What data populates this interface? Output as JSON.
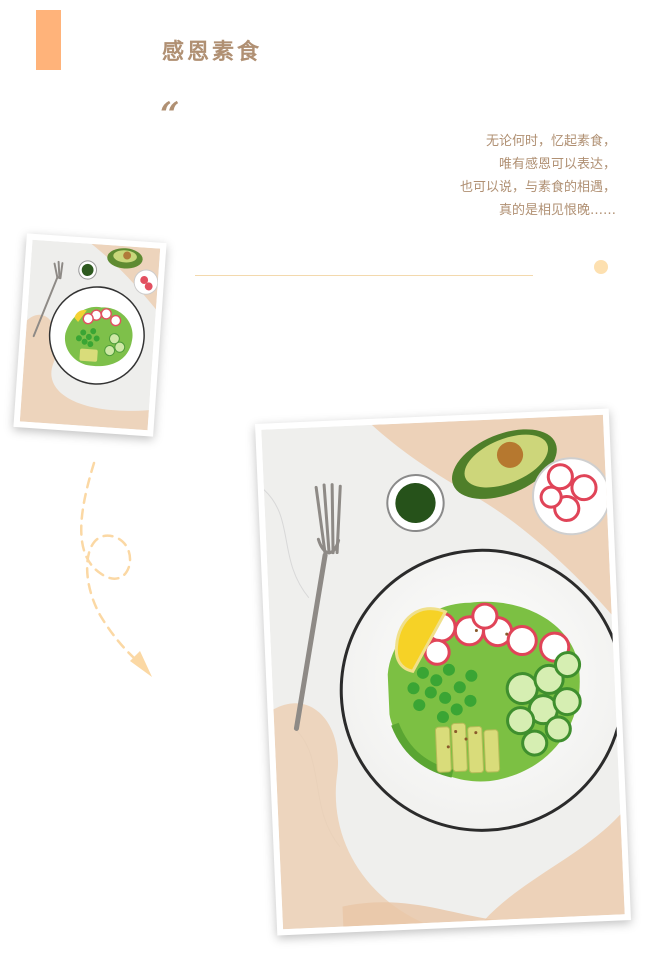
{
  "header": {
    "title": "感恩素食",
    "quote_mark": "“"
  },
  "poem": {
    "lines": [
      "无论何时，忆起素食，",
      "唯有感恩可以表达，",
      "也可以说，与素食的相遇，",
      "真的是相见恨晚……"
    ]
  },
  "colors": {
    "accent": "#ffb37a",
    "text": "#b09073",
    "divider": "#f3d9ad",
    "dot": "#fde0b0"
  },
  "icons": {
    "curve_arrow": "dashed-loop-arrow-icon"
  },
  "photos": {
    "small": "salad-bowl-photo",
    "large": "salad-bowl-photo"
  }
}
